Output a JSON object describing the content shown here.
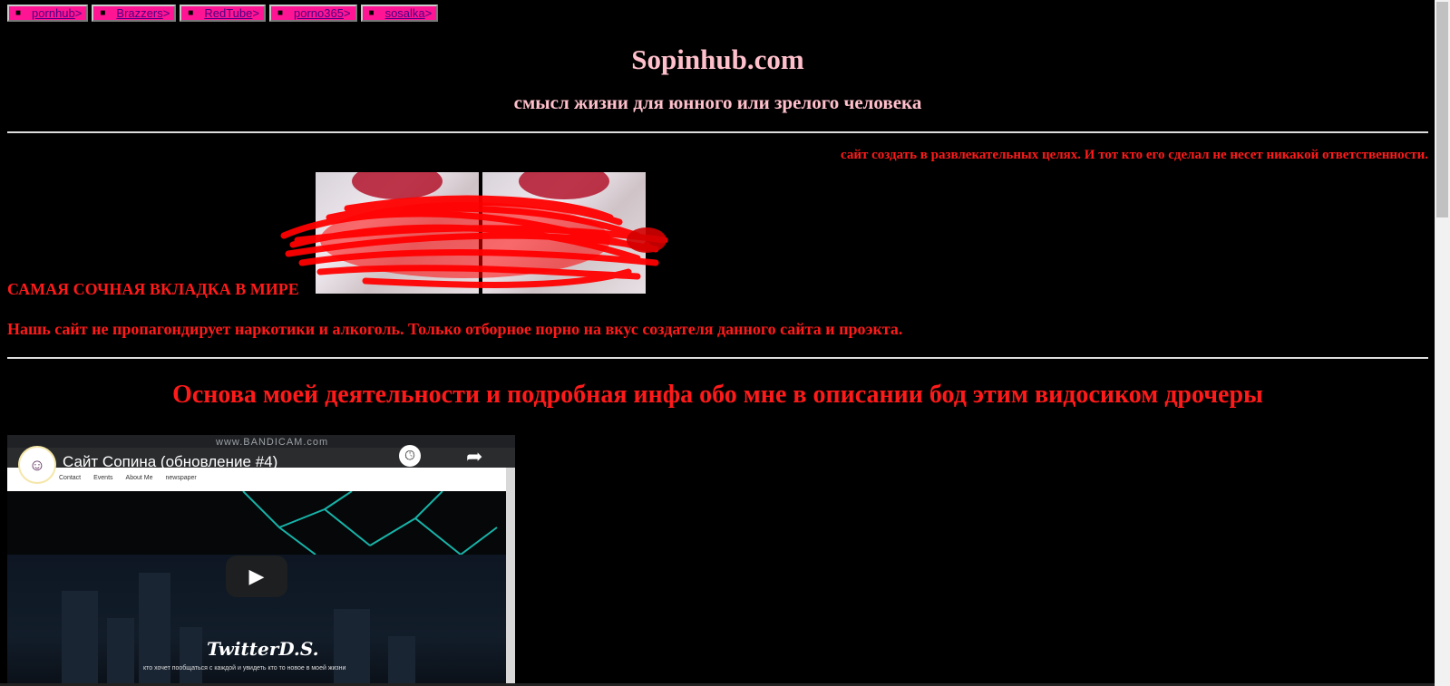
{
  "nav": {
    "items": [
      {
        "label": "pornhub",
        "suffix": ">"
      },
      {
        "label": "Brazzers",
        "suffix": ">"
      },
      {
        "label": "RedTube",
        "suffix": ">"
      },
      {
        "label": "porno365",
        "suffix": ">"
      },
      {
        "label": "sosalka",
        "suffix": ">"
      }
    ],
    "bullet": "■"
  },
  "header": {
    "title": "Sopinhub.com",
    "subtitle": "смысл жизни для юнного или зрелого человека"
  },
  "disclaimer": "сайт создать в развлекательных целях. И тот кто его сделал не несет никакой ответственности.",
  "featured": {
    "label": "САМАЯ СОЧНАЯ ВКЛАДКА В МИРЕ"
  },
  "notice": "Нашь сайт не пропагондирует наркотики и алкоголь. Только отборное порно на вкус создателя данного сайта и проэкта.",
  "section": {
    "heading": "Основа моей деятельности и подробная инфа обо мне в описании бод этим видосиком дрочеры"
  },
  "video": {
    "title": "Сайт Сопина (обновление #4)",
    "watch_later": "Watch later",
    "share": "Share",
    "bandicam": "www.BANDICAM.com",
    "inner_nav": [
      "Contact",
      "Events",
      "About Me",
      "newspaper"
    ],
    "logo_text": "TwitterD.S.",
    "caption": "кто хочет пообщаться с каждой и увидеть кто то новое в моей жизни"
  },
  "colors": {
    "background": "#000000",
    "nav_bg": "#ff1493",
    "title": "#ffc0cb",
    "accent_red": "#ff1a1a"
  }
}
